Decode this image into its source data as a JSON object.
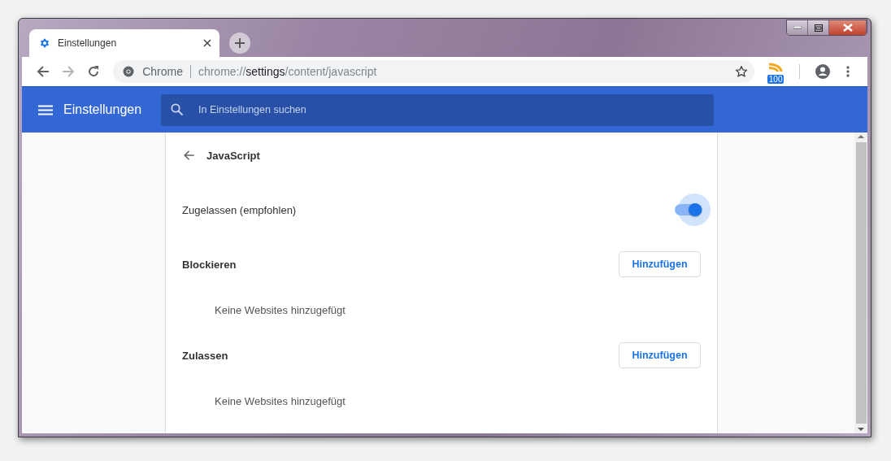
{
  "tab": {
    "title": "Einstellungen",
    "selected": true
  },
  "toolbar": {
    "url": {
      "scheme": "chrome://",
      "host": "settings",
      "path": "/content/javascript"
    },
    "site_label": "Chrome",
    "feed_badge": "100",
    "forward_disabled": true
  },
  "header": {
    "title": "Einstellungen",
    "search": {
      "placeholder": "In Einstellungen suchen"
    }
  },
  "page": {
    "title": "JavaScript",
    "toggle": {
      "label": "Zugelassen (empfohlen)",
      "on": true
    },
    "sections": [
      {
        "title": "Blockieren",
        "button": "Hinzufügen",
        "empty_text": "Keine Websites hinzugefügt"
      },
      {
        "title": "Zulassen",
        "button": "Hinzufügen",
        "empty_text": "Keine Websites hinzugefügt"
      }
    ]
  }
}
